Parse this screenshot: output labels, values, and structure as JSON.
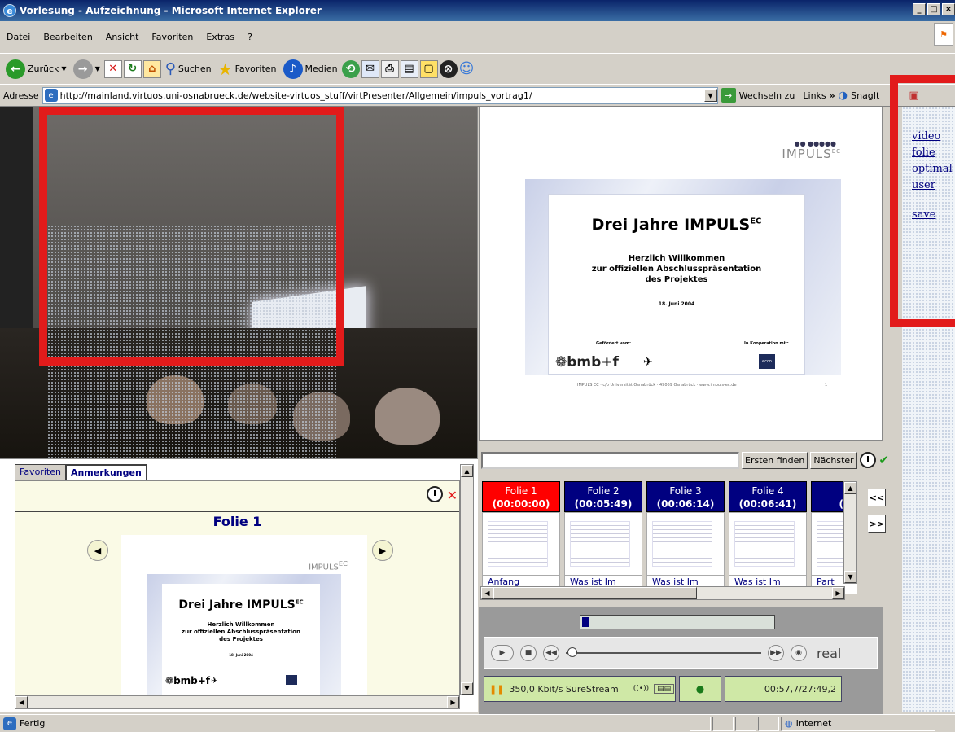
{
  "window": {
    "title": "Vorlesung - Aufzeichnung - Microsoft Internet Explorer",
    "controls": [
      "_",
      "□",
      "×"
    ]
  },
  "menu": [
    "Datei",
    "Bearbeiten",
    "Ansicht",
    "Favoriten",
    "Extras",
    "?"
  ],
  "toolbar": {
    "back": "Zurück",
    "search": "Suchen",
    "favorites": "Favoriten",
    "media": "Medien"
  },
  "address": {
    "label": "Adresse",
    "url": "http://mainland.virtuos.uni-osnabrueck.de/website-virtuos_stuff/virtPresenter/Allgemein/impuls_vortrag1/",
    "go": "Wechseln zu",
    "links": "Links",
    "chevron": "»",
    "snagit": "SnagIt"
  },
  "slide": {
    "logo": "IMPULS",
    "logo_sup": "EC",
    "title": "Drei Jahre IMPULS",
    "title_sup": "EC",
    "welcome": [
      "Herzlich Willkommen",
      "zur offiziellen Abschlusspräsentation",
      "des Projektes"
    ],
    "date": "18. Juni 2004",
    "funded": "Gefördert vom:",
    "coop": "In Kooperation mit:",
    "bmbf": "bmb+f",
    "dlr": "DLR",
    "ecco": "ecco",
    "footer": "IMPULS EC · c/o Universität Osnabrück · 49069 Osnabrück · www.impuls-ec.de",
    "page": "1"
  },
  "search": {
    "placeholder": "",
    "find_first": "Ersten finden",
    "find_next": "Nächster"
  },
  "thumbnails": [
    {
      "label": "Folie 1",
      "time": "(00:00:00)",
      "caption": "Anfang",
      "active": true
    },
    {
      "label": "Folie 2",
      "time": "(00:05:49)",
      "caption": "Was ist Im",
      "active": false
    },
    {
      "label": "Folie 3",
      "time": "(00:06:14)",
      "caption": "Was ist Im",
      "active": false
    },
    {
      "label": "Folie 4",
      "time": "(00:06:41)",
      "caption": "Was ist Im",
      "active": false
    },
    {
      "label": "Fo",
      "time": "(00:",
      "caption": "Part",
      "active": false
    }
  ],
  "nav": {
    "prev": "<<",
    "next": ">>"
  },
  "player": {
    "progress": 0.035,
    "real": "real",
    "bitrate": "350,0 Kbit/s SureStream",
    "time": "00:57,7/27:49,2"
  },
  "notes": {
    "tabs": [
      "Favoriten",
      "Anmerkungen"
    ],
    "active_tab": "Anmerkungen",
    "slide_title": "Folie 1"
  },
  "side_links": [
    "video",
    "folie",
    "optimal",
    "user",
    "save"
  ],
  "status": {
    "left": "Fertig",
    "zone": "Internet"
  },
  "colors": {
    "accent_red": "#e21b1b",
    "thumb_active": "#ff0000",
    "thumb_header": "#000080",
    "player_status": "#cfe8a6"
  }
}
